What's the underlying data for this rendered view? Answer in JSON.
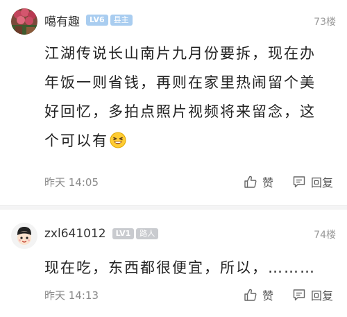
{
  "comments": [
    {
      "username": "噶有趣",
      "level": "LV6",
      "title": "县主",
      "floor": "73楼",
      "content_lines": [
        "江湖传说长山南片九月份要拆，现在办",
        "年饭一则省钱，再则在家里热闹留个美",
        "好回忆，多拍点照片视频将来留念，这",
        "个可以有"
      ],
      "emoji": "laughing-emoji",
      "time": "昨天 14:05",
      "like_label": "赞",
      "reply_label": "回复"
    },
    {
      "username": "zxl641012",
      "level": "LV1",
      "title": "路人",
      "floor": "74楼",
      "content_lines": [
        "现在吃，东西都很便宜，所以，………"
      ],
      "time": "昨天 14:13",
      "like_label": "赞",
      "reply_label": "回复"
    }
  ],
  "colors": {
    "badge_high": "#a9cdf0",
    "badge_low": "#c9cbcf",
    "meta_text": "#8a8a8a"
  }
}
